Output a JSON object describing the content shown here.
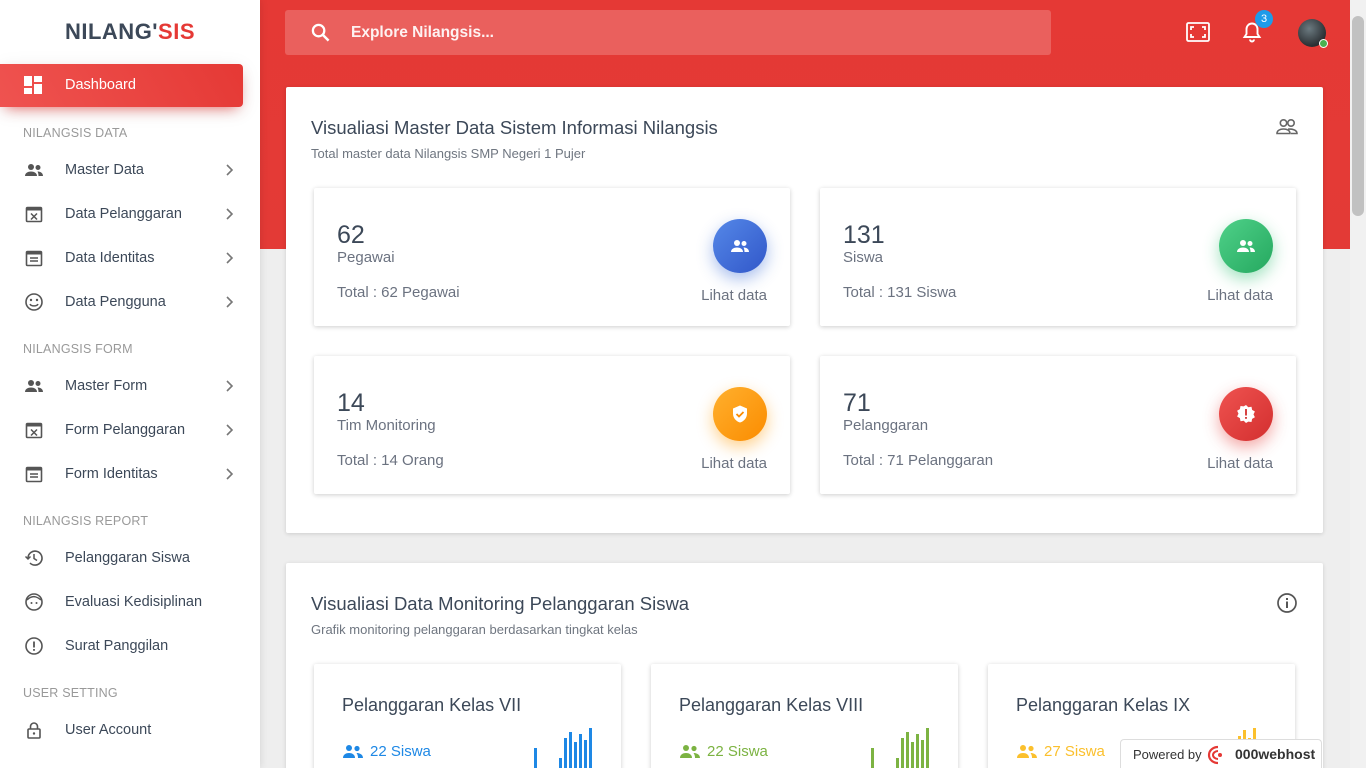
{
  "brand": {
    "name_main": "NILANG'",
    "name_accent": "SIS"
  },
  "sidebar": {
    "active": {
      "label": "Dashboard"
    },
    "sections": [
      {
        "title": "NILANGSIS DATA"
      },
      {
        "title": "NILANGSIS FORM"
      },
      {
        "title": "NILANGSIS REPORT"
      },
      {
        "title": "USER SETTING"
      }
    ],
    "items": [
      {
        "label": "Master Data",
        "icon": "users-icon"
      },
      {
        "label": "Data Pelanggaran",
        "icon": "calendar-x-icon"
      },
      {
        "label": "Data Identitas",
        "icon": "calendar-note-icon"
      },
      {
        "label": "Data Pengguna",
        "icon": "smile-icon"
      },
      {
        "label": "Master Form",
        "icon": "users-icon"
      },
      {
        "label": "Form Pelanggaran",
        "icon": "calendar-x-icon"
      },
      {
        "label": "Form Identitas",
        "icon": "calendar-note-icon"
      },
      {
        "label": "Pelanggaran Siswa",
        "icon": "history-icon"
      },
      {
        "label": "Evaluasi Kedisiplinan",
        "icon": "face-icon"
      },
      {
        "label": "Surat Panggilan",
        "icon": "alert-circle-icon"
      },
      {
        "label": "User Account",
        "icon": "lock-icon"
      }
    ]
  },
  "header": {
    "search_placeholder": "Explore Nilangsis...",
    "notification_count": "3"
  },
  "master_panel": {
    "title": "Visualiasi Master Data Sistem Informasi Nilangsis",
    "subtitle": "Total master data Nilangsis SMP Negeri 1 Pujer",
    "cards": [
      {
        "number": "62",
        "caption": "Pegawai",
        "total": "Total : 62 Pegawai",
        "link": "Lihat data",
        "color": "#3f6fd8",
        "icon": "users-icon"
      },
      {
        "number": "131",
        "caption": "Siswa",
        "total": "Total : 131 Siswa",
        "link": "Lihat data",
        "color": "#2fbf71",
        "icon": "users-icon"
      },
      {
        "number": "14",
        "caption": "Tim Monitoring",
        "total": "Total : 14 Orang",
        "link": "Lihat data",
        "color": "#ff9800",
        "icon": "shield-check-icon"
      },
      {
        "number": "71",
        "caption": "Pelanggaran",
        "total": "Total : 71 Pelanggaran",
        "link": "Lihat data",
        "color": "#e53935",
        "icon": "alert-badge-icon"
      }
    ]
  },
  "monitor_panel": {
    "title": "Visualiasi Data Monitoring Pelanggaran Siswa",
    "subtitle": "Grafik monitoring pelanggaran berdasarkan tingkat kelas",
    "cards": [
      {
        "title": "Pelanggaran Kelas VII",
        "count": "22 Siswa",
        "color": "#1e88e5"
      },
      {
        "title": "Pelanggaran Kelas VIII",
        "count": "22 Siswa",
        "color": "#7cb342"
      },
      {
        "title": "Pelanggaran Kelas IX",
        "count": "27 Siswa",
        "color": "#fbc02d"
      }
    ]
  },
  "footer": {
    "powered_by": "Powered by",
    "host": "000webhost"
  }
}
